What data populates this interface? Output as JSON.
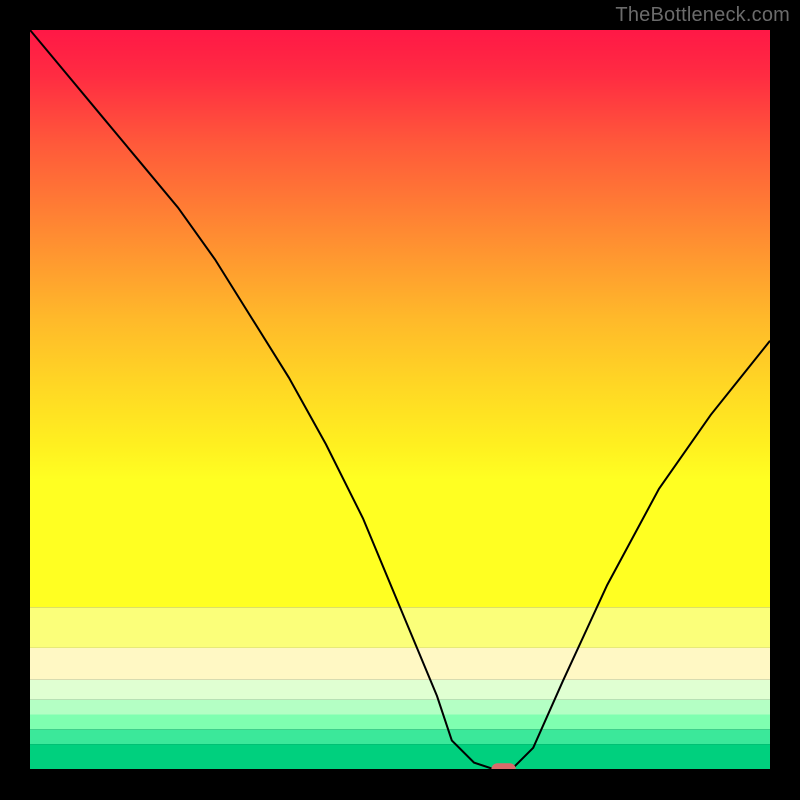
{
  "watermark": "TheBottleneck.com",
  "chart_data": {
    "type": "line",
    "title": "",
    "xlabel": "",
    "ylabel": "",
    "xlim": [
      0,
      100
    ],
    "ylim": [
      0,
      100
    ],
    "grid": false,
    "legend": false,
    "background": {
      "type": "vertical-gradient-with-bands",
      "gradient_stops": [
        {
          "pos": 0.0,
          "color": "#ff1846"
        },
        {
          "pos": 0.08,
          "color": "#ff2c42"
        },
        {
          "pos": 0.2,
          "color": "#ff5a3a"
        },
        {
          "pos": 0.35,
          "color": "#ff8a32"
        },
        {
          "pos": 0.5,
          "color": "#ffb92a"
        },
        {
          "pos": 0.62,
          "color": "#ffd824"
        },
        {
          "pos": 0.72,
          "color": "#fff020"
        },
        {
          "pos": 0.78,
          "color": "#ffff22"
        }
      ],
      "bands": [
        {
          "y0": 0.78,
          "y1": 0.835,
          "color": "#fbff7a"
        },
        {
          "y0": 0.835,
          "y1": 0.878,
          "color": "#fff8c4"
        },
        {
          "y0": 0.878,
          "y1": 0.905,
          "color": "#e0ffd2"
        },
        {
          "y0": 0.905,
          "y1": 0.925,
          "color": "#b4ffc4"
        },
        {
          "y0": 0.925,
          "y1": 0.945,
          "color": "#7fffb0"
        },
        {
          "y0": 0.945,
          "y1": 0.965,
          "color": "#3be89a"
        },
        {
          "y0": 0.965,
          "y1": 1.0,
          "color": "#00d07e"
        }
      ]
    },
    "series": [
      {
        "name": "bottleneck-curve",
        "color": "#000000",
        "stroke_width": 2,
        "x": [
          0,
          5,
          10,
          15,
          20,
          25,
          30,
          35,
          40,
          45,
          50,
          55,
          57,
          60,
          63,
          65,
          68,
          72,
          78,
          85,
          92,
          100
        ],
        "y": [
          100,
          94,
          88,
          82,
          76,
          69,
          61,
          53,
          44,
          34,
          22,
          10,
          4,
          1,
          0,
          0,
          3,
          12,
          25,
          38,
          48,
          58
        ]
      }
    ],
    "marker": {
      "name": "target-marker",
      "shape": "rounded-rect",
      "color": "#d96a6a",
      "cx": 64,
      "cy": 0,
      "w_frac": 0.033,
      "h_frac": 0.018
    }
  }
}
